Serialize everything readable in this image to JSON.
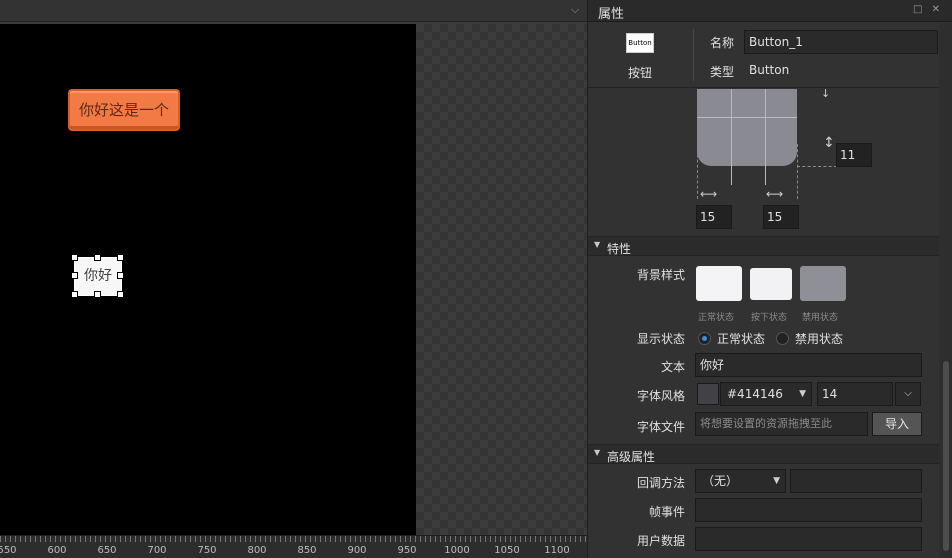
{
  "editor": {
    "topbar_chevron": "⌵",
    "canvas_buttons": {
      "orange_text": "你好这是一个",
      "selected_text": "你好"
    },
    "ruler": {
      "labels": [
        "550",
        "600",
        "650",
        "700",
        "750",
        "800",
        "850",
        "900",
        "950",
        "1000",
        "1050",
        "1100"
      ]
    }
  },
  "panel": {
    "title": "属性",
    "title_icons": "□ ✕",
    "widget_type_thumb": "Button",
    "widget_type_label": "按钮",
    "name_label": "名称",
    "name_value": "Button_1",
    "type_label": "类型",
    "type_value": "Button",
    "nine_slice": {
      "right_value": "11",
      "left_value": "15",
      "mid_value": "15"
    },
    "section_properties": "特性",
    "bg_style_label": "背景样式",
    "bg_captions": [
      "正常状态",
      "按下状态",
      "禁用状态"
    ],
    "display_state_label": "显示状态",
    "radio_normal": "正常状态",
    "radio_disabled": "禁用状态",
    "text_label": "文本",
    "text_value": "你好",
    "font_style_label": "字体风格",
    "font_color": "#414146",
    "font_size": "14",
    "font_file_label": "字体文件",
    "font_file_placeholder": "将想要设置的资源拖拽至此",
    "import_label": "导入",
    "section_advanced": "高级属性",
    "callback_label": "回调方法",
    "callback_value": "（无）",
    "frame_event_label": "帧事件",
    "user_data_label": "用户数据"
  },
  "colors": {
    "orange_button": "#f27a45",
    "accent_radio": "#3b8ee4",
    "text_color": "#414146"
  }
}
